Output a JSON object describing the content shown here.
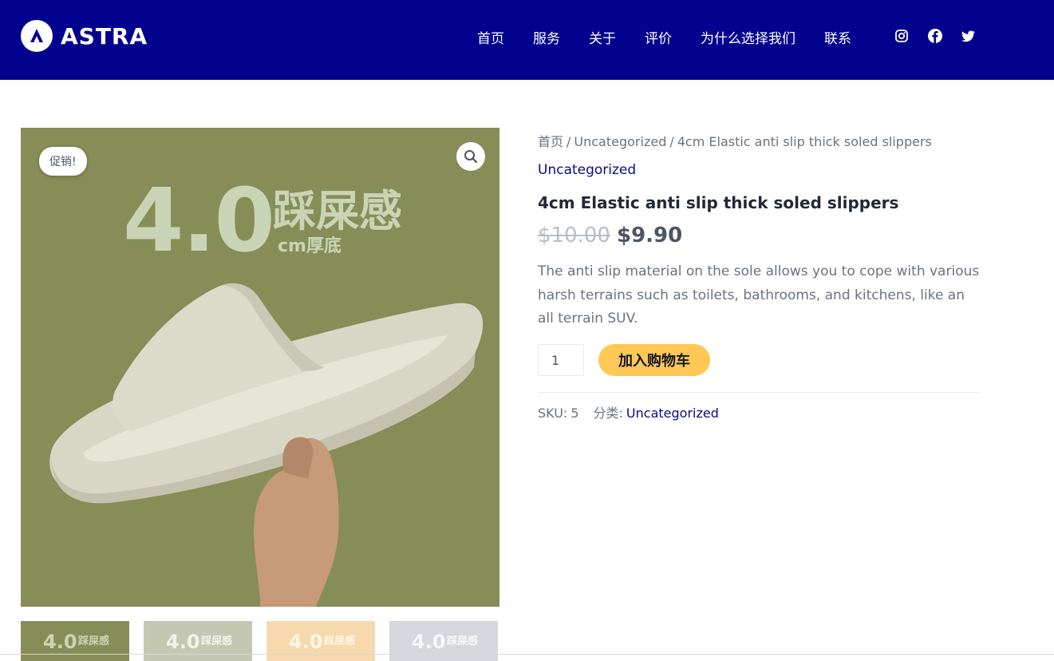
{
  "header": {
    "logo_text": "ASTRA",
    "nav": [
      "首页",
      "服务",
      "关于",
      "评价",
      "为什么选择我们",
      "联系"
    ],
    "social_icons": [
      "instagram-icon",
      "facebook-icon",
      "twitter-icon"
    ],
    "bg_color": "#03028f"
  },
  "gallery": {
    "sale_badge": "促销!",
    "image_text_number": "4.0",
    "image_text_cn": "踩屎感",
    "image_text_sub": "cm厚底",
    "thumbnails": [
      {
        "number": "4.0",
        "cn": "踩屎感",
        "bg": "#868d56",
        "fg": "#c9d3b6"
      },
      {
        "number": "4.0",
        "cn": "踩屎感",
        "bg": "#c4c8b2",
        "fg": "#f1f2e8"
      },
      {
        "number": "4.0",
        "cn": "踩屎感",
        "bg": "#f6d9ad",
        "fg": "#fff6e6"
      },
      {
        "number": "4.0",
        "cn": "踩屎感",
        "bg": "#d6d7dc",
        "fg": "#f7f7f9"
      }
    ]
  },
  "product": {
    "breadcrumb": [
      "首页",
      "Uncategorized",
      "4cm Elastic anti slip thick soled slippers"
    ],
    "category": "Uncategorized",
    "title": "4cm Elastic anti slip thick soled slippers",
    "old_price": "$10.00",
    "price": "$9.90",
    "description": "The anti slip material on the sole allows you to cope with various harsh terrains such as toilets, bathrooms, and kitchens, like an all terrain SUV.",
    "quantity": "1",
    "add_to_cart": "加入购物车",
    "sku_label": "SKU:",
    "sku_value": "5",
    "category_label": "分类:",
    "category_value": "Uncategorized"
  }
}
